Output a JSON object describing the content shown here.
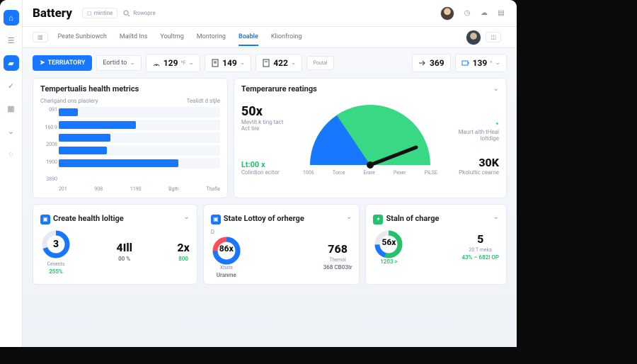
{
  "brand": "Battery",
  "top": {
    "chip1": "mintine",
    "search_placeholder": "Rowopre"
  },
  "tabs": [
    "Peate Sunbiowch",
    "Mailtd Ins",
    "Youltrng",
    "Montoring",
    "Boable",
    "Klionfroing"
  ],
  "active_tab": 4,
  "toolbar": {
    "primary": "TERRIATORY",
    "dd1": "Eortid to",
    "metrics": [
      {
        "icon": "gauge",
        "value": "129",
        "unit": "ºF"
      },
      {
        "icon": "doc",
        "value": "149",
        "unit": ""
      },
      {
        "icon": "doc",
        "value": "422",
        "unit": ""
      },
      {
        "icon": "",
        "value": "",
        "unit": "",
        "label": "Poutal"
      },
      {
        "icon": "arrow",
        "value": "369",
        "unit": ""
      },
      {
        "icon": "batt",
        "value": "139",
        "unit": "º"
      }
    ]
  },
  "card_bars": {
    "title": "Tempertualis health metrics",
    "left_sub": "Charigand ons plaolery",
    "right_sub": "Tealidt d stjle",
    "y": [
      "091",
      "160.9",
      "2008",
      "1900",
      "3890"
    ],
    "x": [
      "201",
      "908",
      "1190",
      "Bgth",
      "Thafla"
    ]
  },
  "chart_data": {
    "type": "bar",
    "orientation": "horizontal",
    "categories": [
      "091",
      "160.9",
      "2008",
      "1900",
      "3890"
    ],
    "values": [
      12,
      48,
      32,
      30,
      74
    ],
    "xlabel": "",
    "ylabel": "",
    "title": "Tempertualis health metrics",
    "ylim": [
      0,
      100
    ]
  },
  "gauge": {
    "title": "Temperarure reatings",
    "big": "50x",
    "big_sub": "Mevtit.k ting tact Act tire",
    "left_tag": "Lt:00 x",
    "left_sub": "Colirdion ecitor",
    "right_top_sub": "Maurt aith tHeal loltdige",
    "right_num": "30K",
    "right_sub": "Pkolultic cearne",
    "ticks": [
      "1006",
      "Torce",
      "Erare",
      "Pexer",
      "PILSE"
    ],
    "value_deg": 125
  },
  "bottom": {
    "c1": {
      "title": "Create health loltige",
      "m1": {
        "num": "3",
        "lbl": "Cevents",
        "sub": "255%"
      },
      "m2": {
        "num": "4Ill",
        "sub": "00 %"
      },
      "m3": {
        "num": "2x",
        "sub": "800"
      }
    },
    "c2": {
      "title": "State Lottoy of orherge",
      "pre": "D",
      "m1": {
        "num": "86x",
        "lbl": "Xbate",
        "sub": "Uranme"
      },
      "m2": {
        "num": "768",
        "lbl": "Themal",
        "sub": "368   CB03tr"
      }
    },
    "c3": {
      "title": "Staln of charge",
      "m1": {
        "num": "56x",
        "sub": "1203 >"
      },
      "m2": {
        "num": "5",
        "lbl": "20 T meka",
        "sub": "43% – 682l OP"
      }
    }
  }
}
